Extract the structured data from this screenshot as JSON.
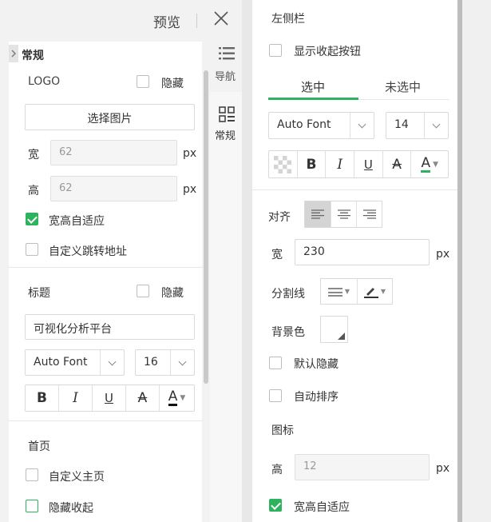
{
  "header": {
    "preview_label": "预览"
  },
  "side_tabs": [
    {
      "label": "导航",
      "icon": "list-icon"
    },
    {
      "label": "常规",
      "icon": "grid-icon"
    }
  ],
  "general": {
    "section_title": "常规",
    "logo": {
      "label": "LOGO",
      "hide_label": "隐藏",
      "choose_image_label": "选择图片",
      "width_label": "宽",
      "width_value": "62",
      "height_label": "高",
      "height_value": "62",
      "unit": "px",
      "auto_fit_label": "宽高自适应",
      "custom_link_label": "自定义跳转地址"
    },
    "title": {
      "label": "标题",
      "hide_label": "隐藏",
      "value": "可视化分析平台",
      "font": "Auto Font",
      "size": "16",
      "bold": "B",
      "italic": "I",
      "underline": "U",
      "strike": "A",
      "color": "A"
    },
    "home": {
      "label": "首页",
      "custom_home_label": "自定义主页",
      "hide_collapse_label": "隐藏收起"
    }
  },
  "sidebar": {
    "section_title": "左侧栏",
    "show_collapse_label": "显示收起按钮",
    "tabs": [
      "选中",
      "未选中"
    ],
    "font": "Auto Font",
    "size": "14",
    "bold": "B",
    "italic": "I",
    "underline": "U",
    "strike": "A",
    "color": "A",
    "align_label": "对齐",
    "width_label": "宽",
    "width_value": "230",
    "unit": "px",
    "divider_label": "分割线",
    "bg_color_label": "背景色",
    "default_hide_label": "默认隐藏",
    "auto_sort_label": "自动排序",
    "icon_label": "图标",
    "icon_height_label": "高",
    "icon_height_value": "12",
    "auto_fit_label": "宽高自适应"
  },
  "colors": {
    "accent": "#2db35d"
  }
}
